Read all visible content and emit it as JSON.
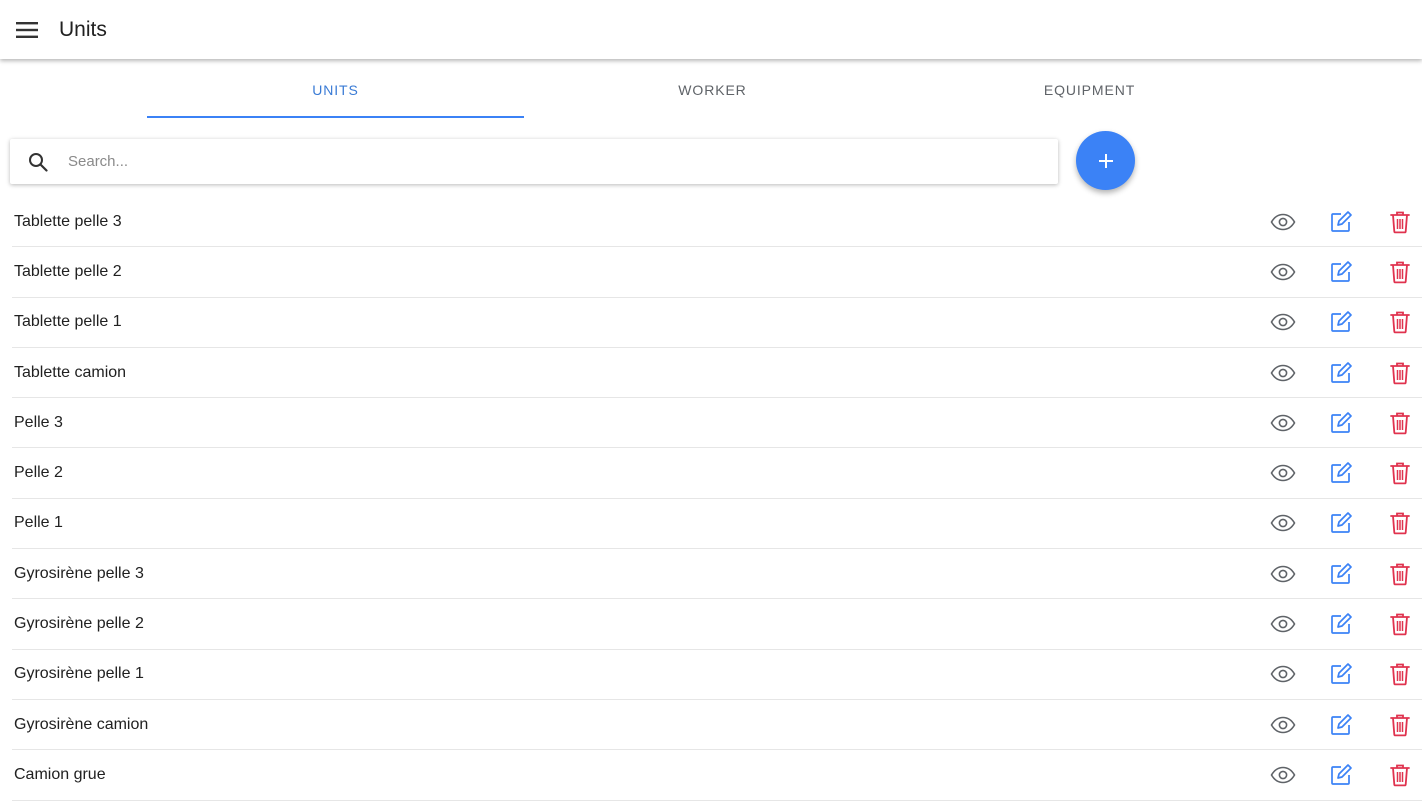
{
  "app_bar": {
    "title": "Units",
    "menu_icon": "menu-icon"
  },
  "tabs": [
    {
      "label": "UNITS",
      "active": true
    },
    {
      "label": "WORKER",
      "active": false
    },
    {
      "label": "EQUIPMENT",
      "active": false
    }
  ],
  "search": {
    "placeholder": "Search...",
    "value": "",
    "icon": "search-icon"
  },
  "fab": {
    "icon": "plus-icon"
  },
  "colors": {
    "accent": "#3b82f6",
    "tab_active_text": "#3a7bd5",
    "edit_icon": "#3b82f6",
    "delete_icon": "#e0334f",
    "view_icon": "#5f6368"
  },
  "items": [
    {
      "label": "Tablette pelle 3"
    },
    {
      "label": "Tablette pelle 2"
    },
    {
      "label": "Tablette pelle 1"
    },
    {
      "label": "Tablette camion"
    },
    {
      "label": "Pelle 3"
    },
    {
      "label": "Pelle 2"
    },
    {
      "label": "Pelle 1"
    },
    {
      "label": "Gyrosirène pelle 3"
    },
    {
      "label": "Gyrosirène pelle 2"
    },
    {
      "label": "Gyrosirène pelle 1"
    },
    {
      "label": "Gyrosirène camion"
    },
    {
      "label": "Camion grue"
    }
  ],
  "row_actions": [
    "eye-icon",
    "edit-icon",
    "trash-icon"
  ]
}
